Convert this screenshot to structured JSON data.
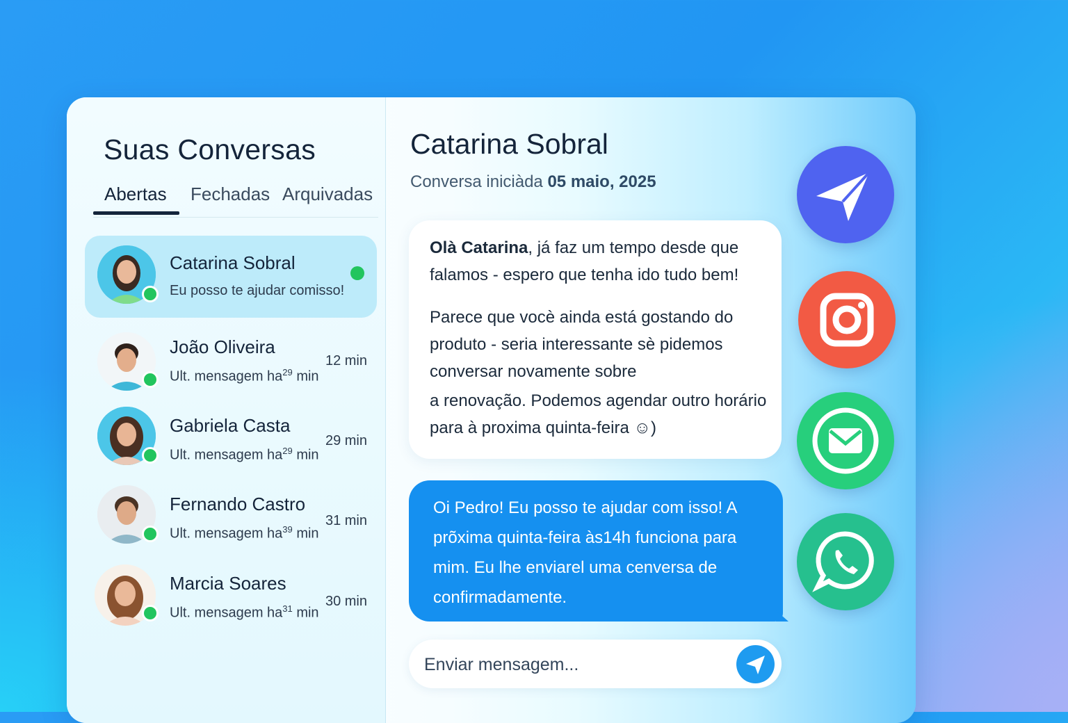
{
  "sidebar": {
    "title": "Suas Conversas",
    "tabs": [
      {
        "label": "Abertas",
        "active": true
      },
      {
        "label": "Fechadas",
        "active": false
      },
      {
        "label": "Arquivadas",
        "active": false
      }
    ],
    "conversations": [
      {
        "name": "Catarina Sobral",
        "preview": "Eu posso te ajudar comisso!",
        "time": "",
        "selected": true,
        "online": true
      },
      {
        "name": "João Oliveira",
        "preview_prefix": "Ult. mensagem ha",
        "preview_sup": "29",
        "preview_suffix": " min",
        "time": "12 min",
        "online": true
      },
      {
        "name": "Gabriela Casta",
        "preview_prefix": "Ult. mensagem ha",
        "preview_sup": "29",
        "preview_suffix": " min",
        "time": "29 min",
        "online": true
      },
      {
        "name": "Fernando Castro",
        "preview_prefix": "Ult. mensagem ha",
        "preview_sup": "39",
        "preview_suffix": " min",
        "time": "31 min",
        "online": true
      },
      {
        "name": "Marcia Soares",
        "preview_prefix": "Ult. mensagem ha",
        "preview_sup": "31",
        "preview_suffix": " min",
        "time": "30 min",
        "online": true
      }
    ]
  },
  "chat": {
    "contact_name": "Catarina Sobral",
    "started_label": "Conversa iniciàda",
    "started_date": "05 maio, 2025",
    "incoming": {
      "greeting_bold": "Olà Catarina",
      "para1_rest": ", já faz um tempo desde que falamos - espero que tenha ido tudo bem!",
      "para2": "Parece que vocè ainda está gostando do produto - seria interessante sè pidemos conversar novamente sobre",
      "para3": "a renovação. Podemos agendar outro horário para à proxima quinta-feira ☺)"
    },
    "outgoing": {
      "text": "Oi Pedro!  Eu posso te ajudar com isso! A prõxima quinta-feira às14h funciona para mim. Eu lhe enviarel uma cenversa de confirmadamente."
    },
    "input": {
      "placeholder": "Enviar mensagem..."
    }
  },
  "social_buttons": [
    {
      "name": "telegram",
      "color": "#4f63f0"
    },
    {
      "name": "instagram",
      "color": "#f25a44"
    },
    {
      "name": "email",
      "color": "#27cf7c"
    },
    {
      "name": "whatsapp",
      "color": "#26c08e"
    }
  ],
  "colors": {
    "accent": "#1590f0",
    "online": "#22c55e",
    "selected_row": "#bdebfa"
  }
}
